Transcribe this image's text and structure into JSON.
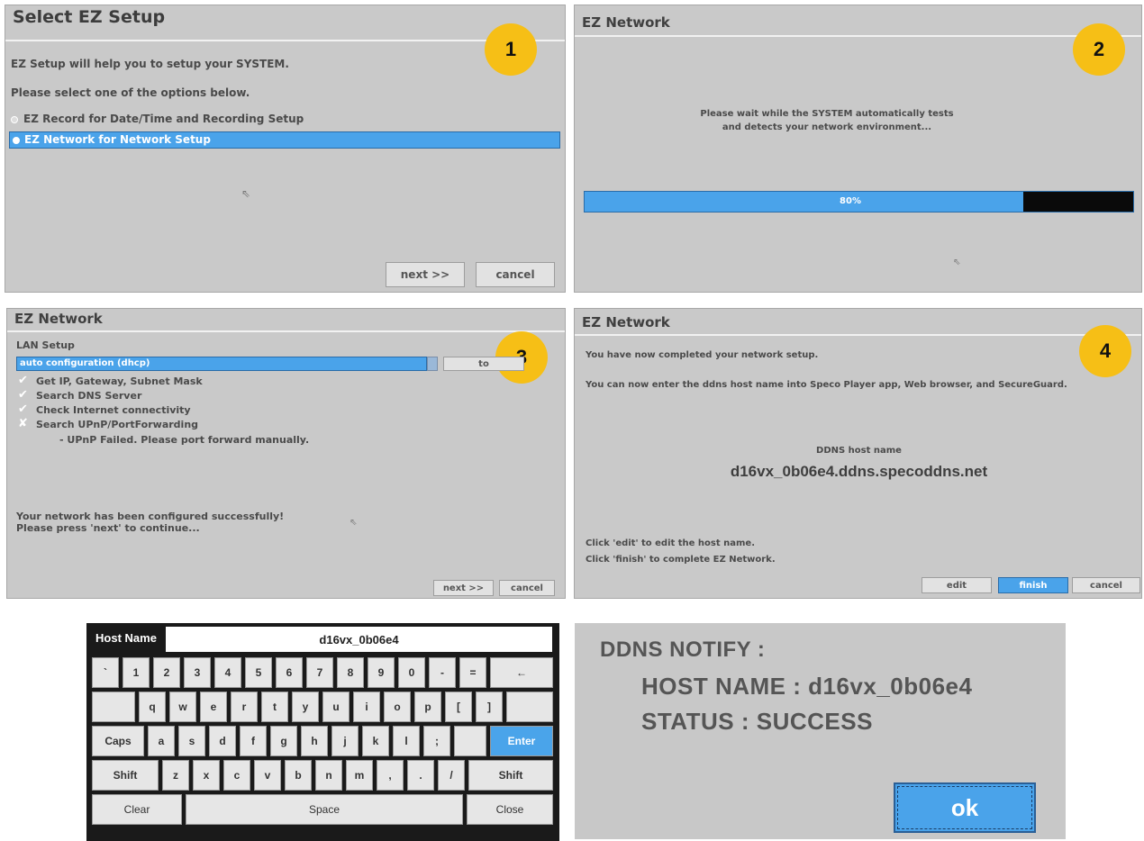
{
  "panel1": {
    "title": "Select EZ Setup",
    "badge": "1",
    "intro": "EZ Setup will help you to setup your SYSTEM.",
    "instruction": "Please select one of the options below.",
    "options": [
      "EZ Record for Date/Time and Recording Setup",
      "EZ Network for Network Setup"
    ],
    "selected_option": 1,
    "next_label": "next >>",
    "cancel_label": "cancel"
  },
  "panel2": {
    "title": "EZ Network",
    "badge": "2",
    "message_line1": "Please wait while the SYSTEM automatically tests",
    "message_line2": "and detects your network environment...",
    "progress_percent": 80,
    "progress_label": "80%"
  },
  "panel3": {
    "title": "EZ Network",
    "badge": "3",
    "section": "LAN Setup",
    "dropdown_value": "auto configuration (dhcp)",
    "side_button": "to",
    "checks": [
      {
        "label": "Get IP, Gateway, Subnet Mask",
        "status": "ok"
      },
      {
        "label": "Search DNS Server",
        "status": "ok"
      },
      {
        "label": "Check Internet connectivity",
        "status": "ok"
      },
      {
        "label": "Search UPnP/PortForwarding",
        "status": "fail"
      }
    ],
    "upnp_note": "- UPnP Failed. Please port forward manually.",
    "result_line1": "Your network has been configured successfully!",
    "result_line2": "Please press 'next' to continue...",
    "next_label": "next >>",
    "cancel_label": "cancel"
  },
  "panel4": {
    "title": "EZ Network",
    "badge": "4",
    "line1": "You have now completed your network setup.",
    "line2": "You can now enter the ddns host name into Speco Player app, Web browser, and SecureGuard.",
    "ddns_label": "DDNS host name",
    "ddns_value": "d16vx_0b06e4.ddns.specoddns.net",
    "hint1": "Click 'edit' to edit the host name.",
    "hint2": "Click 'finish' to complete EZ Network.",
    "edit_label": "edit",
    "finish_label": "finish",
    "cancel_label": "cancel"
  },
  "keyboard": {
    "field_label": "Host Name",
    "field_value": "d16vx_0b06e4",
    "row1": [
      "`",
      "1",
      "2",
      "3",
      "4",
      "5",
      "6",
      "7",
      "8",
      "9",
      "0",
      "-",
      "=",
      "←"
    ],
    "row2": [
      "q",
      "w",
      "e",
      "r",
      "t",
      "y",
      "u",
      "i",
      "o",
      "p",
      "[",
      "]"
    ],
    "row3": [
      "Caps",
      "a",
      "s",
      "d",
      "f",
      "g",
      "h",
      "j",
      "k",
      "l",
      ";",
      "Enter"
    ],
    "row4": [
      "Shift",
      "z",
      "x",
      "c",
      "v",
      "b",
      "n",
      "m",
      ",",
      ".",
      "/",
      "Shift"
    ],
    "row5": [
      "Clear",
      "Space",
      "Close"
    ]
  },
  "notify": {
    "heading": "DDNS NOTIFY :",
    "host_line": "HOST NAME : d16vx_0b06e4",
    "status_line": "STATUS : SUCCESS",
    "ok_label": "ok"
  },
  "colors": {
    "panel_bg": "#c9c9c9",
    "selection_blue": "#4aa3ea",
    "badge_yellow": "#f6bf16",
    "progress_blue": "#4aa3ea"
  }
}
